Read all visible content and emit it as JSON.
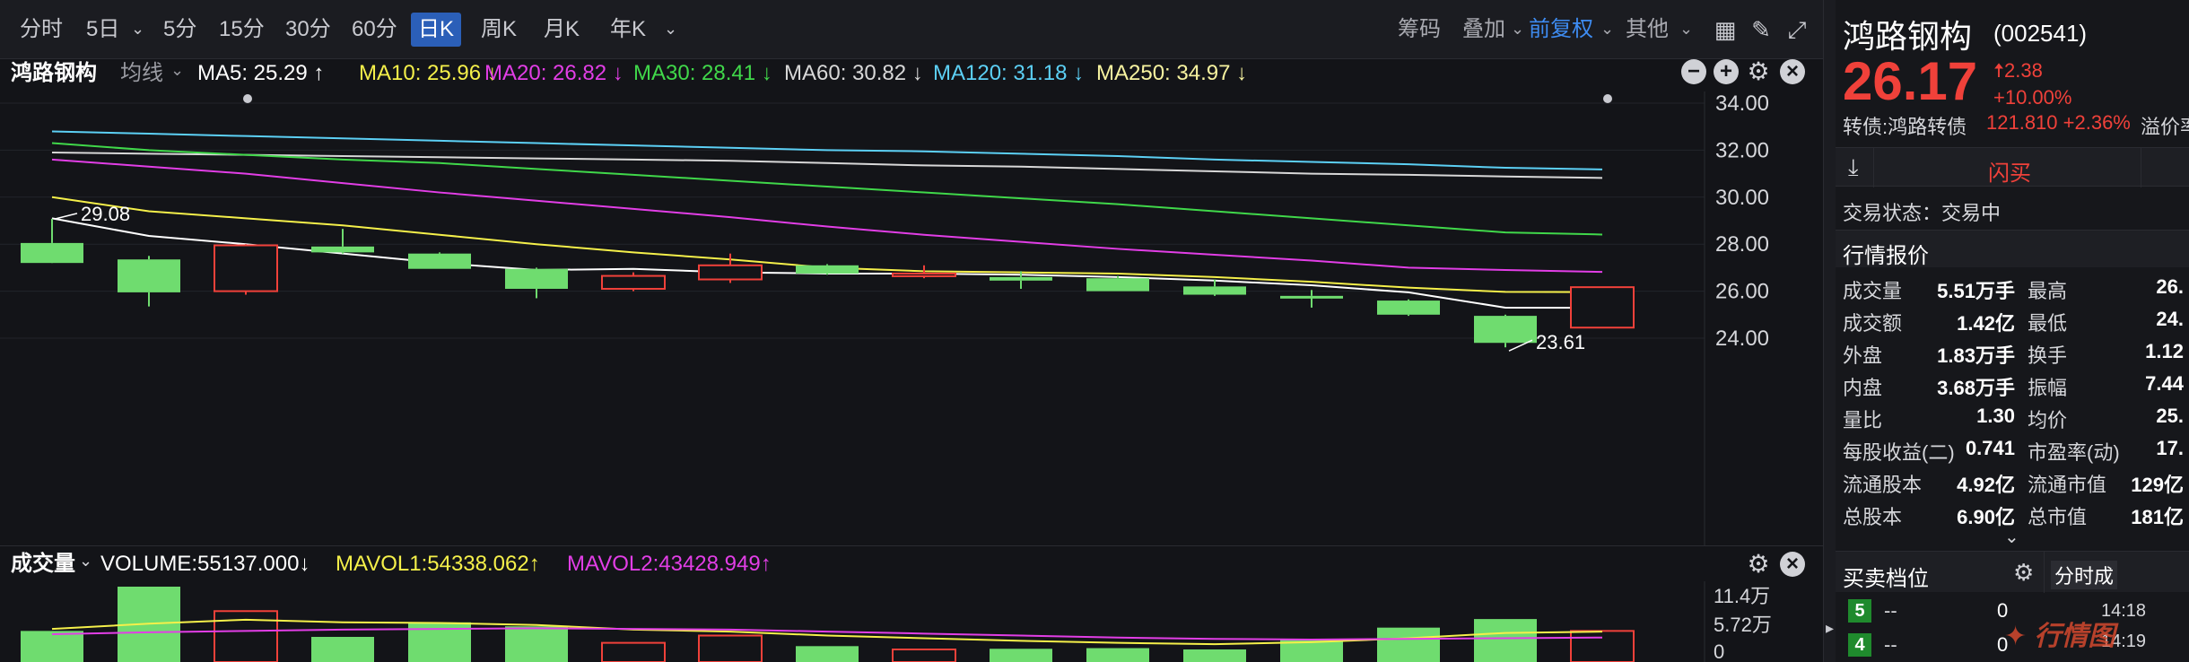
{
  "toolbar": {
    "timeframes": [
      "分时",
      "5日",
      "5分",
      "15分",
      "30分",
      "60分",
      "日K",
      "周K",
      "月K",
      "年K"
    ],
    "active_timeframe": "日K",
    "right_items": {
      "chips": "筹码",
      "overlay": "叠加",
      "adjust": "前复权",
      "other": "其他"
    }
  },
  "ma_bar": {
    "stock_name": "鸿路钢构",
    "indicator": "均线",
    "ma5": "MA5: 25.29",
    "ma10": "MA10: 25.96",
    "ma20": "MA20: 26.82",
    "ma30": "MA30: 28.41",
    "ma60": "MA60: 30.82",
    "ma120": "MA120: 31.18",
    "ma250": "MA250: 34.97",
    "arrows": {
      "ma5": "↑",
      "ma10": "↓",
      "ma20": "↓",
      "ma30": "↓",
      "ma60": "↓",
      "ma120": "↓",
      "ma250": "↓"
    }
  },
  "colors": {
    "up": "#f0413a",
    "down": "#6fdc6f",
    "ma5": "#ffffff",
    "ma10": "#f5f04a",
    "ma20": "#e23ee6",
    "ma30": "#40d84a",
    "ma60": "#d8d8d8",
    "ma120": "#5cd0f5",
    "ma250": "#f7f3a0"
  },
  "chart_data": {
    "type": "candlestick",
    "y_ticks": [
      "34.00",
      "32.00",
      "30.00",
      "28.00",
      "26.00",
      "24.00"
    ],
    "ylim": [
      23.4,
      35.6
    ],
    "annotations": {
      "high_label": "29.08",
      "low_label": "23.61"
    },
    "candles": [
      {
        "o": 28.05,
        "h": 29.08,
        "l": 27.25,
        "c": 27.2
      },
      {
        "o": 27.35,
        "h": 27.5,
        "l": 25.35,
        "c": 25.95
      },
      {
        "o": 26.0,
        "h": 28.0,
        "l": 25.85,
        "c": 27.95
      },
      {
        "o": 27.9,
        "h": 28.65,
        "l": 27.6,
        "c": 27.65
      },
      {
        "o": 27.6,
        "h": 27.65,
        "l": 26.95,
        "c": 26.95
      },
      {
        "o": 26.95,
        "h": 27.0,
        "l": 25.7,
        "c": 26.1
      },
      {
        "o": 26.1,
        "h": 26.8,
        "l": 26.0,
        "c": 26.65
      },
      {
        "o": 26.5,
        "h": 27.6,
        "l": 26.35,
        "c": 27.1
      },
      {
        "o": 27.1,
        "h": 27.15,
        "l": 26.7,
        "c": 26.75
      },
      {
        "o": 26.7,
        "h": 27.1,
        "l": 26.55,
        "c": 26.75
      },
      {
        "o": 26.6,
        "h": 26.85,
        "l": 26.1,
        "c": 26.45
      },
      {
        "o": 26.55,
        "h": 26.65,
        "l": 26.0,
        "c": 26.0
      },
      {
        "o": 26.2,
        "h": 26.5,
        "l": 25.8,
        "c": 25.85
      },
      {
        "o": 25.8,
        "h": 26.05,
        "l": 25.3,
        "c": 25.75
      },
      {
        "o": 25.6,
        "h": 25.65,
        "l": 24.95,
        "c": 25.0
      },
      {
        "o": 24.95,
        "h": 25.0,
        "l": 23.61,
        "c": 23.8
      },
      {
        "o": 24.45,
        "h": 26.17,
        "l": 24.45,
        "c": 26.17
      }
    ],
    "ma_lines": {
      "ma5": [
        29.1,
        28.35,
        28.0,
        27.6,
        27.2,
        26.9,
        26.95,
        26.8,
        26.75,
        26.75,
        26.7,
        26.6,
        26.45,
        26.25,
        25.95,
        25.3,
        25.29
      ],
      "ma10": [
        30.0,
        29.4,
        29.1,
        28.8,
        28.4,
        28.0,
        27.65,
        27.35,
        27.0,
        26.85,
        26.8,
        26.75,
        26.6,
        26.4,
        26.15,
        25.97,
        25.96
      ],
      "ma20": [
        31.6,
        31.3,
        31.0,
        30.6,
        30.2,
        29.85,
        29.5,
        29.15,
        28.75,
        28.4,
        28.1,
        27.8,
        27.55,
        27.3,
        27.0,
        26.9,
        26.82
      ],
      "ma30": [
        32.3,
        32.0,
        31.8,
        31.6,
        31.45,
        31.2,
        30.95,
        30.7,
        30.45,
        30.2,
        29.95,
        29.7,
        29.4,
        29.1,
        28.8,
        28.5,
        28.41
      ],
      "ma60": [
        31.9,
        31.85,
        31.8,
        31.75,
        31.7,
        31.65,
        31.6,
        31.55,
        31.45,
        31.35,
        31.3,
        31.2,
        31.1,
        31.0,
        30.95,
        30.88,
        30.82
      ],
      "ma120": [
        32.8,
        32.7,
        32.6,
        32.5,
        32.4,
        32.3,
        32.2,
        32.1,
        32.0,
        31.95,
        31.85,
        31.75,
        31.6,
        31.5,
        31.4,
        31.25,
        31.18
      ],
      "ma250": [
        null,
        null,
        null,
        null,
        null,
        null,
        null,
        null,
        null,
        35.6,
        35.5,
        35.42,
        35.35,
        35.25,
        35.15,
        35.05,
        34.97
      ]
    },
    "volume": {
      "header": "成交量",
      "volume_label": "VOLUME:55137.000↓",
      "mavol1_label": "MAVOL1:54338.062↑",
      "mavol2_label": "MAVOL2:43428.949↑",
      "y_ticks": [
        "11.4万",
        "5.72万",
        "0"
      ],
      "bars": [
        4.7,
        11.4,
        7.7,
        3.8,
        6.0,
        5.4,
        2.9,
        4.0,
        2.4,
        1.9,
        2.0,
        2.1,
        1.9,
        3.5,
        5.2,
        6.5,
        4.7
      ],
      "mavol1": [
        5.0,
        5.8,
        6.4,
        6.0,
        5.9,
        5.6,
        4.9,
        4.6,
        4.0,
        3.6,
        3.2,
        2.9,
        2.7,
        3.0,
        3.6,
        4.4,
        4.6
      ],
      "mavol2": [
        4.2,
        4.5,
        4.7,
        4.9,
        5.0,
        5.1,
        5.0,
        4.9,
        4.6,
        4.3,
        4.0,
        3.7,
        3.5,
        3.4,
        3.5,
        3.6,
        3.7
      ]
    }
  },
  "quote": {
    "name": "鸿路钢构",
    "code": "(002541)",
    "price": "26.17",
    "change": "2.38",
    "change_pct": "+10.00%",
    "convertible_label": "转债:鸿路转债",
    "convertible_value": "121.810 +2.36%",
    "premium_label": "溢价率",
    "flash_buy": "闪买",
    "trade_status": "交易状态：交易中",
    "market_section": "行情报价",
    "rows": [
      {
        "l1": "成交量",
        "v1": "5.51万手",
        "l2": "最高",
        "v2": "26.",
        "c1": "",
        "c2": "red"
      },
      {
        "l1": "成交额",
        "v1": "1.42亿",
        "l2": "最低",
        "v2": "24.",
        "c1": "",
        "c2": "red"
      },
      {
        "l1": "外盘",
        "v1": "1.83万手",
        "l2": "换手",
        "v2": "1.12",
        "c1": "red",
        "c2": ""
      },
      {
        "l1": "内盘",
        "v1": "3.68万手",
        "l2": "振幅",
        "v2": "7.44",
        "c1": "green",
        "c2": ""
      },
      {
        "l1": "量比",
        "v1": "1.30",
        "l2": "均价",
        "v2": "25.",
        "c1": "",
        "c2": "red"
      },
      {
        "l1": "每股收益(二)",
        "v1": "0.741",
        "l2": "市盈率(动)",
        "v2": "17.",
        "c1": "",
        "c2": ""
      },
      {
        "l1": "流通股本",
        "v1": "4.92亿",
        "l2": "流通市值",
        "v2": "129亿",
        "c1": "",
        "c2": ""
      },
      {
        "l1": "总股本",
        "v1": "6.90亿",
        "l2": "总市值",
        "v2": "181亿",
        "c1": "",
        "c2": ""
      }
    ],
    "order_book_section": "买卖档位",
    "order_book": [
      {
        "level": "5",
        "price": "--",
        "qty": "0"
      },
      {
        "level": "4",
        "price": "--",
        "qty": "0"
      }
    ],
    "tab_label": "分时成",
    "tick_times": [
      "14:18",
      "14:19"
    ],
    "watermark": "行情图"
  }
}
